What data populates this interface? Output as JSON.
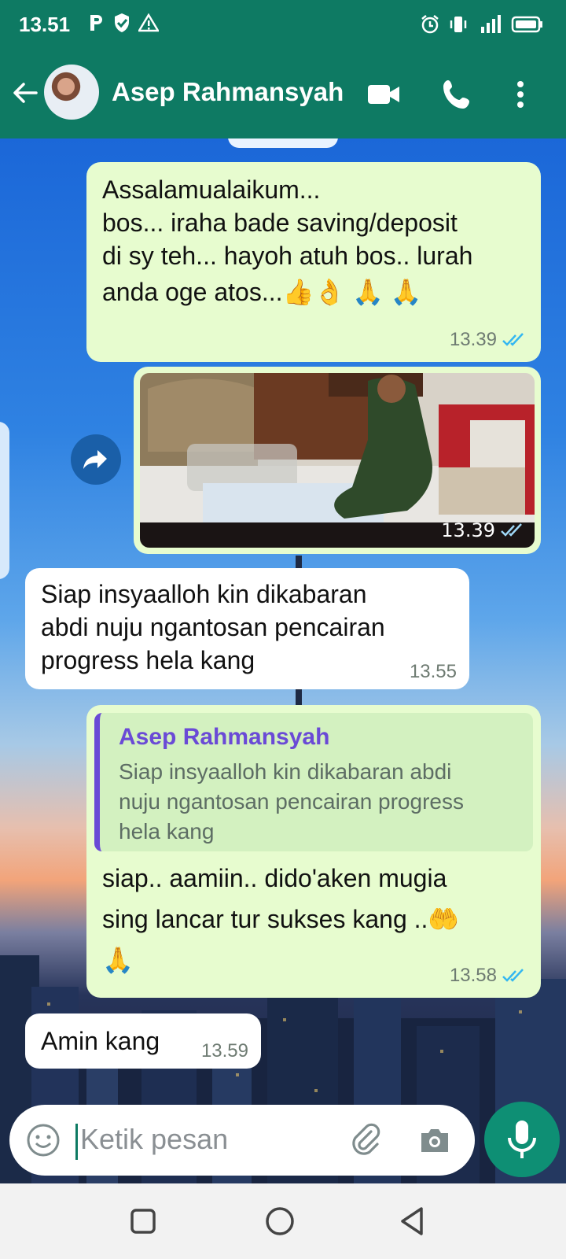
{
  "status_bar": {
    "time": "13.51"
  },
  "header": {
    "contact_name": "Asep Rahmansyah"
  },
  "messages": [
    {
      "direction": "out",
      "text_lines": [
        "Assalamualaikum...",
        "bos... iraha bade saving/deposit",
        "di sy teh... hayoh atuh bos.. lurah",
        "anda oge atos...👍👌 🙏 🙏"
      ],
      "time": "13.39"
    },
    {
      "direction": "out",
      "type": "image",
      "time": "13.39"
    },
    {
      "direction": "in",
      "text_lines": [
        "Siap insyaalloh kin dikabaran",
        "abdi nuju ngantosan pencairan",
        "progress hela kang"
      ],
      "time": "13.55"
    },
    {
      "direction": "out",
      "quote": {
        "name": "Asep Rahmansyah",
        "text_lines": [
          "Siap insyaalloh kin dikabaran abdi",
          "nuju ngantosan pencairan progress",
          "hela kang"
        ]
      },
      "text_lines": [
        "siap.. aamiin.. dido'aken mugia",
        "sing lancar tur sukses kang ..🤲",
        "🙏"
      ],
      "time": "13.58"
    },
    {
      "direction": "in",
      "text": "Amin kang",
      "time": "13.59"
    }
  ],
  "input": {
    "placeholder": "Ketik pesan"
  },
  "colors": {
    "header": "#0e7a63",
    "outgoing_bubble": "#e7fccf",
    "incoming_bubble": "#ffffff",
    "tick_blue": "#34b7f1",
    "quote_accent": "#6a4ad6"
  }
}
